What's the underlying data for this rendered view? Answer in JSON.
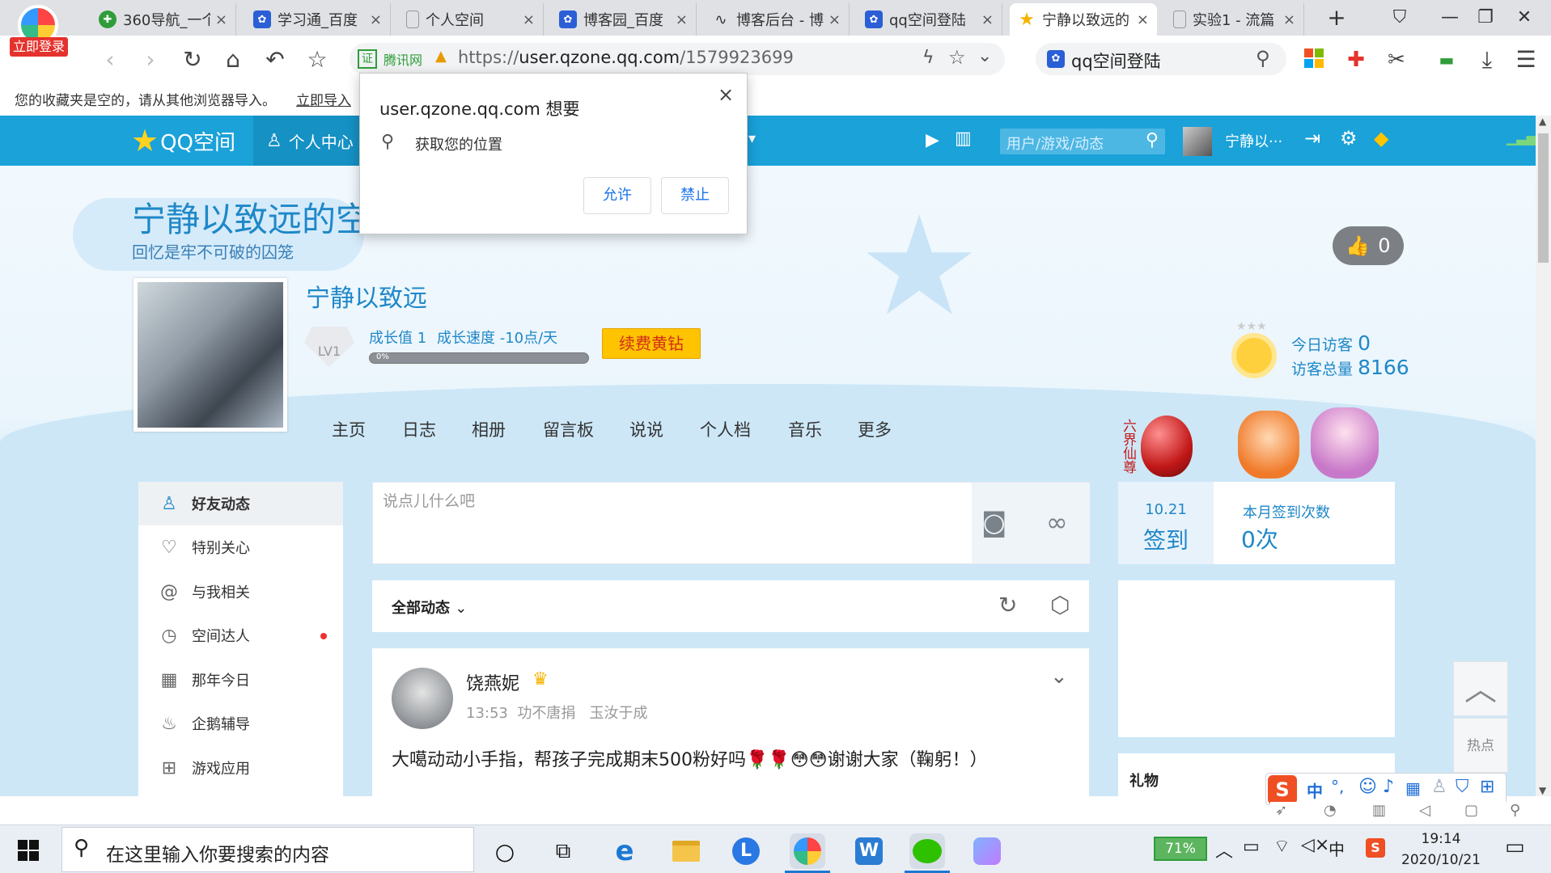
{
  "tabs": [
    {
      "title": "360导航_一个",
      "close": "×",
      "color": "#2f9d3a",
      "glyph": "✚"
    },
    {
      "title": "学习通_百度",
      "close": "×",
      "color": "#2b5fd6",
      "glyph": "🐾"
    },
    {
      "title": "个人空间",
      "close": "×",
      "color": "#9aa0a6",
      "glyph": "▯"
    },
    {
      "title": "博客园_百度",
      "close": "×",
      "color": "#2b5fd6",
      "glyph": "🐾"
    },
    {
      "title": "博客后台 - 博",
      "close": "×",
      "color": "#444",
      "glyph": "∿"
    },
    {
      "title": "qq空间登陆",
      "close": "×",
      "color": "#2b5fd6",
      "glyph": "🐾"
    },
    {
      "title": "宁静以致远的",
      "close": "×",
      "color": "#f5b400",
      "glyph": "★"
    },
    {
      "title": "实验1 - 流篇",
      "close": "×",
      "color": "#9aa0a6",
      "glyph": "▯"
    }
  ],
  "browser": {
    "login_label": "立即登录",
    "url_badge": "证",
    "url_site": "腾讯网",
    "url_prefix": "https://",
    "url_host": "user.qzone.qq.com",
    "url_path": "/1579923699",
    "search_text": "qq空间登陆",
    "bookmark_notice": "您的收藏夹是空的，请从其他浏览器导入。",
    "bookmark_import": "立即导入"
  },
  "permission_popup": {
    "title": "user.qzone.qq.com 想要",
    "request": "获取您的位置",
    "allow": "允许",
    "deny": "禁止",
    "close": "×"
  },
  "qzone": {
    "logo_text": "QQ空间",
    "personal_center": "个人中心",
    "search_placeholder": "用户/游戏/动态",
    "username_short": "宁静以···",
    "space_title": "宁静以致远的空",
    "space_subtitle": "回忆是牢不可破的囚笼",
    "like_count": "0",
    "nickname": "宁静以致远",
    "level_badge": "LV1",
    "growth_value": "成长值 1",
    "growth_speed": "成长速度 -10点/天",
    "progress_text": "0%",
    "progress_fraction": 0,
    "renew_label": "续费黄钻",
    "visitors_today_label": "今日访客",
    "visitors_today": "0",
    "visitors_total_label": "访客总量",
    "visitors_total": "8166",
    "nav": [
      "主页",
      "日志",
      "相册",
      "留言板",
      "说说",
      "个人档",
      "音乐",
      "更多"
    ],
    "liujie_label": "六界仙尊",
    "left_menu": [
      {
        "label": "好友动态",
        "icon": "friends-icon",
        "glyph": "👥"
      },
      {
        "label": "特别关心",
        "icon": "heart-icon",
        "glyph": "♡"
      },
      {
        "label": "与我相关",
        "icon": "at-icon",
        "glyph": "@"
      },
      {
        "label": "空间达人",
        "icon": "play-circle-icon",
        "glyph": "▷"
      },
      {
        "label": "那年今日",
        "icon": "calendar-icon",
        "glyph": "▦"
      },
      {
        "label": "企鹅辅导",
        "icon": "penguin-icon",
        "glyph": "♨"
      },
      {
        "label": "游戏应用",
        "icon": "grid-icon",
        "glyph": "⊞"
      }
    ],
    "post_placeholder": "说点儿什么吧",
    "filter_label": "全部动态",
    "feed": {
      "author": "饶燕妮",
      "time": "13:53",
      "tag1": "功不唐捐",
      "tag2": "玉汝于成",
      "text": "大噶动动小手指，帮孩子完成期末500粉好吗🌹🌹😳😳谢谢大家（鞠躬！）"
    },
    "checkin_date": "10.21",
    "checkin_label": "签到",
    "monthly_label": "本月签到次数",
    "monthly_count": "0次",
    "gift_label": "礼物",
    "hot_label": "热点"
  },
  "ime": {
    "lang": "中",
    "punct": "°,"
  },
  "taskbar": {
    "search_placeholder": "在这里输入你要搜索的内容",
    "battery_percent": "71%",
    "ime_lang": "中",
    "time": "19:14",
    "date": "2020/10/21"
  }
}
